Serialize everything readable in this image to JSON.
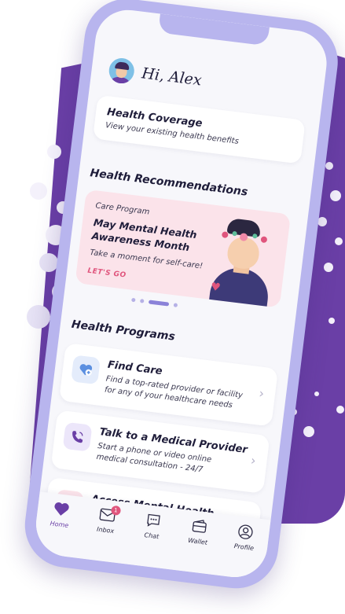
{
  "greeting": {
    "text": "Hi, Alex"
  },
  "coverage_card": {
    "title": "Health Coverage",
    "subtitle": "View your existing health benefits"
  },
  "recommendations": {
    "heading": "Health Recommendations",
    "promo": {
      "eyebrow": "Care Program",
      "headline": "May Mental Health Awareness Month",
      "subtitle": "Take a moment for self-care!",
      "cta": "LET'S GO"
    },
    "pager": {
      "pages": 4,
      "active": 2
    }
  },
  "programs": {
    "heading": "Health Programs",
    "items": [
      {
        "title": "Find Care",
        "subtitle": "Find a top-rated provider or facility for any of your healthcare needs",
        "icon": "heart-plus-icon"
      },
      {
        "title": "Talk to a Medical Provider",
        "subtitle": "Start a phone or video online medical consultation - 24/7",
        "icon": "phone-call-icon"
      },
      {
        "title": "Access Mental Health",
        "subtitle": "",
        "icon": "mind-icon"
      }
    ]
  },
  "tabbar": {
    "items": [
      {
        "label": "Home",
        "icon": "heart-icon",
        "active": true
      },
      {
        "label": "Inbox",
        "icon": "mail-icon",
        "badge": "1"
      },
      {
        "label": "Chat",
        "icon": "chat-icon"
      },
      {
        "label": "Wallet",
        "icon": "wallet-icon"
      },
      {
        "label": "Profile",
        "icon": "user-icon"
      }
    ]
  },
  "colors": {
    "brand_purple": "#6a3fa6",
    "phone_frame": "#b8b5ee",
    "promo_bg": "#fbe3ea",
    "accent_pink": "#e0557d"
  }
}
